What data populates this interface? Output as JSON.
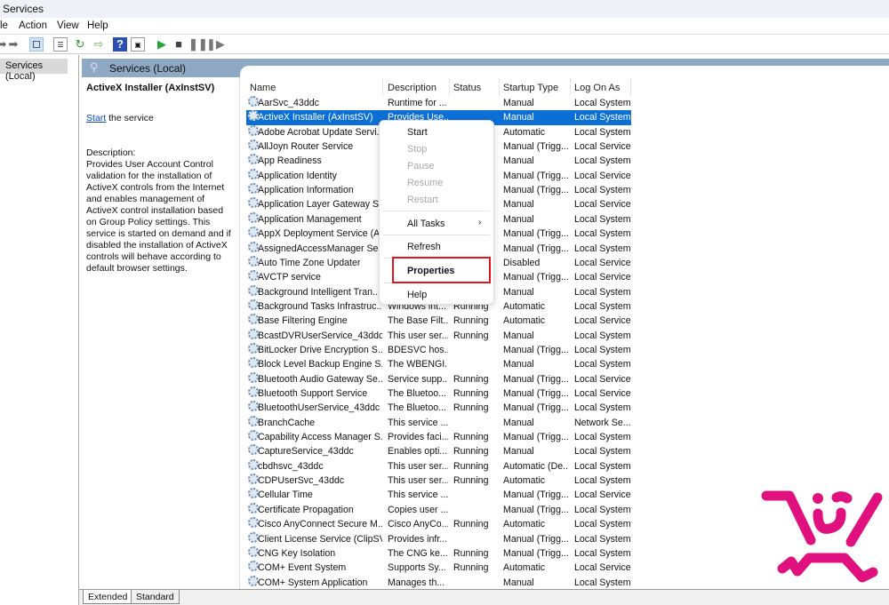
{
  "window": {
    "title": "Services"
  },
  "menubar": [
    "le",
    "Action",
    "View",
    "Help"
  ],
  "toolbar": {
    "icons": [
      "back-arrow-icon",
      "forward-arrow-icon",
      "show-hide-console-tree-icon",
      "properties-icon",
      "refresh-icon",
      "export-list-icon",
      "help-icon",
      "show-hide-action-pane-icon",
      "start-service-icon",
      "stop-service-icon",
      "pause-service-icon",
      "restart-service-icon"
    ]
  },
  "tree": {
    "selected": "Services (Local)"
  },
  "panel": {
    "title": "Services (Local)"
  },
  "details": {
    "service_name": "ActiveX Installer (AxInstSV)",
    "start_link": "Start",
    "start_suffix": " the service",
    "description_label": "Description:",
    "description": "Provides User Account Control validation for the installation of ActiveX controls from the Internet and enables management of ActiveX control installation based on Group Policy settings. This service is started on demand and if disabled the installation of ActiveX controls will behave according to default browser settings."
  },
  "columns": [
    "Name",
    "Description",
    "Status",
    "Startup Type",
    "Log On As"
  ],
  "rows": [
    [
      "AarSvc_43ddc",
      "Runtime for ...",
      "",
      "Manual",
      "Local System"
    ],
    [
      "ActiveX Installer (AxInstSV)",
      "Provides Use...",
      "",
      "Manual",
      "Local System"
    ],
    [
      "Adobe Acrobat Update Servi...",
      "",
      "",
      "Automatic",
      "Local System"
    ],
    [
      "AllJoyn Router Service",
      "",
      "",
      "Manual (Trigg...",
      "Local Service"
    ],
    [
      "App Readiness",
      "",
      "",
      "Manual",
      "Local System"
    ],
    [
      "Application Identity",
      "",
      "",
      "Manual (Trigg...",
      "Local Service"
    ],
    [
      "Application Information",
      "",
      "",
      "Manual (Trigg...",
      "Local System"
    ],
    [
      "Application Layer Gateway S...",
      "",
      "",
      "Manual",
      "Local Service"
    ],
    [
      "Application Management",
      "",
      "",
      "Manual",
      "Local System"
    ],
    [
      "AppX Deployment Service (A...",
      "",
      "",
      "Manual (Trigg...",
      "Local System"
    ],
    [
      "AssignedAccessManager Ser...",
      "",
      "",
      "Manual (Trigg...",
      "Local System"
    ],
    [
      "Auto Time Zone Updater",
      "",
      "",
      "Disabled",
      "Local Service"
    ],
    [
      "AVCTP service",
      "",
      "",
      "Manual (Trigg...",
      "Local Service"
    ],
    [
      "Background Intelligent Tran...",
      "",
      "",
      "Manual",
      "Local System"
    ],
    [
      "Background Tasks Infrastruc...",
      "Windows int...",
      "Running",
      "Automatic",
      "Local System"
    ],
    [
      "Base Filtering Engine",
      "The Base Filt...",
      "Running",
      "Automatic",
      "Local Service"
    ],
    [
      "BcastDVRUserService_43ddc",
      "This user ser...",
      "Running",
      "Manual",
      "Local System"
    ],
    [
      "BitLocker Drive Encryption S...",
      "BDESVC hos...",
      "",
      "Manual (Trigg...",
      "Local System"
    ],
    [
      "Block Level Backup Engine S...",
      "The WBENGI...",
      "",
      "Manual",
      "Local System"
    ],
    [
      "Bluetooth Audio Gateway Se...",
      "Service supp...",
      "Running",
      "Manual (Trigg...",
      "Local Service"
    ],
    [
      "Bluetooth Support Service",
      "The Bluetoo...",
      "Running",
      "Manual (Trigg...",
      "Local Service"
    ],
    [
      "BluetoothUserService_43ddc",
      "The Bluetoo...",
      "Running",
      "Manual (Trigg...",
      "Local System"
    ],
    [
      "BranchCache",
      "This service ...",
      "",
      "Manual",
      "Network Se..."
    ],
    [
      "Capability Access Manager S...",
      "Provides faci...",
      "Running",
      "Manual (Trigg...",
      "Local System"
    ],
    [
      "CaptureService_43ddc",
      "Enables opti...",
      "Running",
      "Manual",
      "Local System"
    ],
    [
      "cbdhsvc_43ddc",
      "This user ser...",
      "Running",
      "Automatic (De...",
      "Local System"
    ],
    [
      "CDPUserSvc_43ddc",
      "This user ser...",
      "Running",
      "Automatic",
      "Local System"
    ],
    [
      "Cellular Time",
      "This service ...",
      "",
      "Manual (Trigg...",
      "Local Service"
    ],
    [
      "Certificate Propagation",
      "Copies user ...",
      "",
      "Manual (Trigg...",
      "Local System"
    ],
    [
      "Cisco AnyConnect Secure M...",
      "Cisco AnyCo...",
      "Running",
      "Automatic",
      "Local System"
    ],
    [
      "Client License Service (ClipSV...",
      "Provides infr...",
      "",
      "Manual (Trigg...",
      "Local System"
    ],
    [
      "CNG Key Isolation",
      "The CNG ke...",
      "Running",
      "Manual (Trigg...",
      "Local System"
    ],
    [
      "COM+ Event System",
      "Supports Sy...",
      "Running",
      "Automatic",
      "Local Service"
    ],
    [
      "COM+ System Application",
      "Manages th...",
      "",
      "Manual",
      "Local System"
    ]
  ],
  "selected_row": 1,
  "context_menu": {
    "items": [
      {
        "label": "Start",
        "enabled": true
      },
      {
        "label": "Stop",
        "enabled": false
      },
      {
        "label": "Pause",
        "enabled": false
      },
      {
        "label": "Resume",
        "enabled": false
      },
      {
        "label": "Restart",
        "enabled": false
      },
      {
        "label": "All Tasks",
        "enabled": true,
        "submenu": true
      },
      {
        "label": "Refresh",
        "enabled": true
      },
      {
        "label": "Properties",
        "enabled": true,
        "bold": true,
        "highlighted": true
      },
      {
        "label": "Help",
        "enabled": true
      }
    ]
  },
  "bottom_tabs": [
    "Extended",
    "Standard"
  ],
  "colors": {
    "selection": "#0b6fd6",
    "highlight_box": "#e0131f",
    "panel_header": "#8fa8c4",
    "logo": "#e0107e"
  }
}
